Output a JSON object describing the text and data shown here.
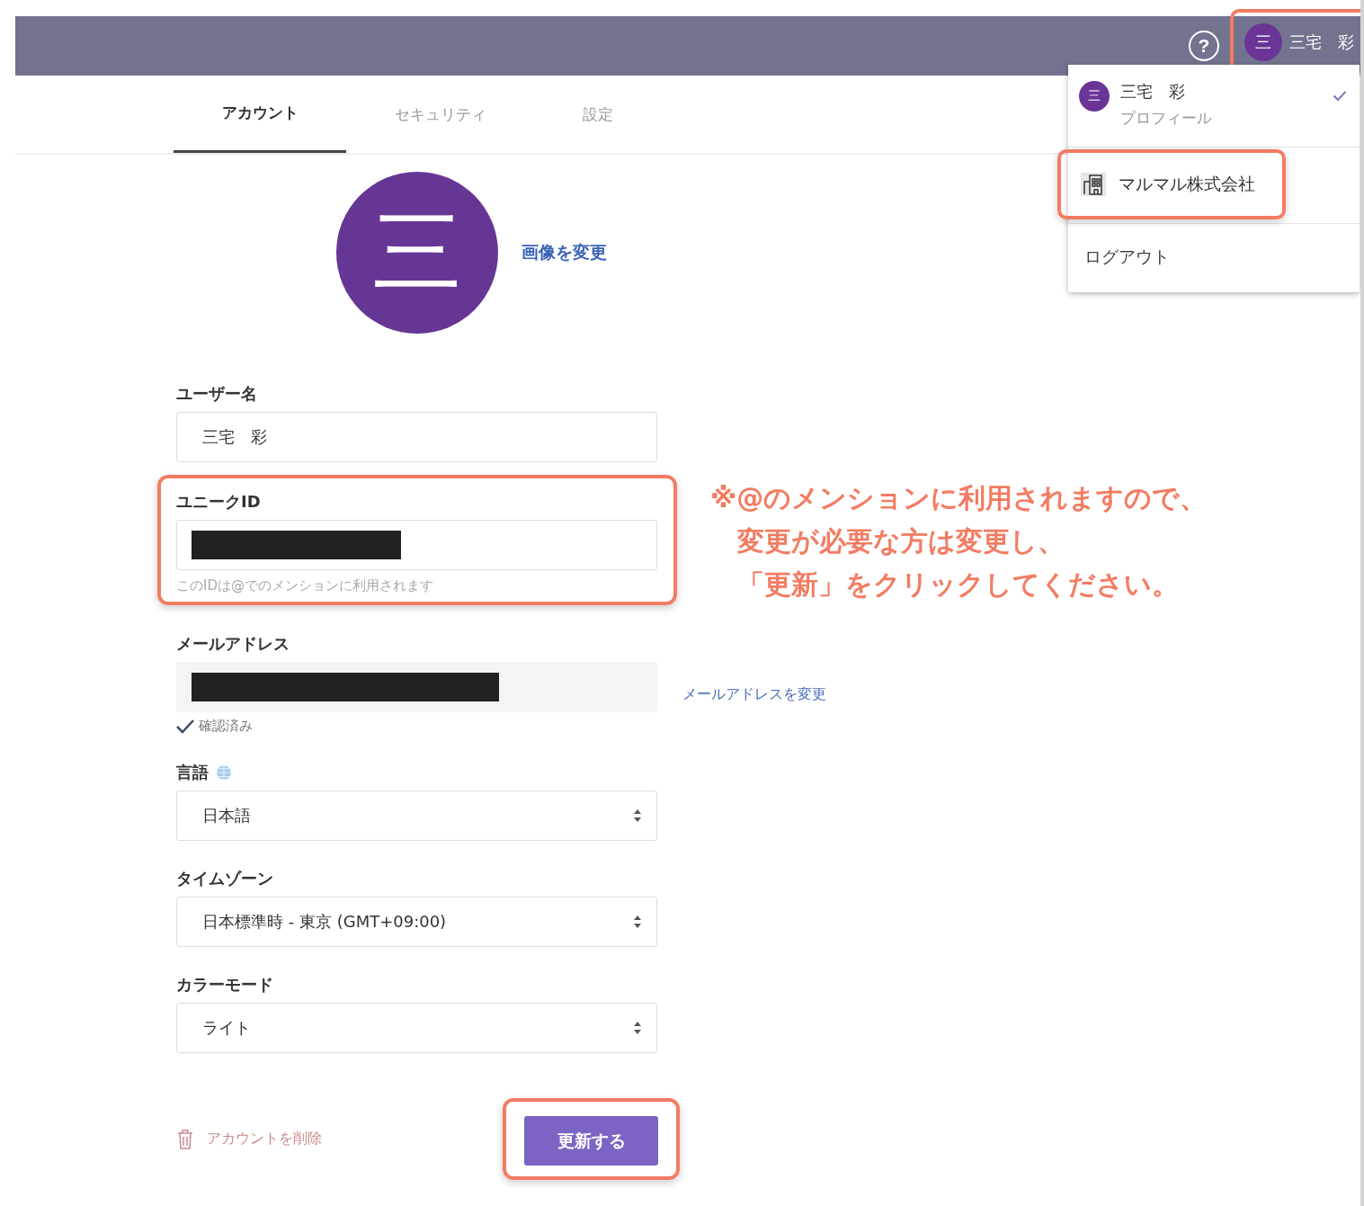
{
  "header": {
    "help_icon": "?",
    "user": {
      "initial": "三",
      "name": "三宅　彩",
      "highlighted": true
    }
  },
  "user_menu": {
    "items": [
      {
        "kind": "profile",
        "initial": "三",
        "title": "三宅　彩",
        "subtitle": "プロフィール",
        "selected": true
      },
      {
        "kind": "organization",
        "title": "マルマル株式会社",
        "selected": false,
        "highlighted": true
      },
      {
        "kind": "logout",
        "title": "ログアウト"
      }
    ]
  },
  "tabs": [
    {
      "label": "アカウント",
      "selected": true
    },
    {
      "label": "セキュリティ",
      "selected": false
    },
    {
      "label": "設定",
      "selected": false
    }
  ],
  "avatar": {
    "initial": "三",
    "change_link": "画像を変更"
  },
  "form": {
    "fields": [
      {
        "kind": "text",
        "label": "ユーザー名",
        "value": "三宅　彩"
      },
      {
        "kind": "text",
        "label": "ユニークID",
        "redacted": true,
        "hint": "このIDは@でのメンションに利用されます",
        "highlighted": true
      },
      {
        "kind": "readonly",
        "label": "メールアドレス",
        "redacted": true,
        "link": "メールアドレスを変更",
        "verified": true,
        "verified_label": "確認済み"
      },
      {
        "kind": "select",
        "label": "言語",
        "label_icon": true,
        "value": "日本語"
      },
      {
        "kind": "select",
        "label": "タイムゾーン",
        "value": "日本標準時 - 東京 (GMT+09:00)"
      },
      {
        "kind": "select",
        "label": "カラーモード",
        "value": "ライト"
      }
    ]
  },
  "delete_link": "アカウントを削除",
  "submit": {
    "label": "更新する",
    "highlighted": true
  },
  "note": {
    "lines": [
      "※@のメンションに利用されますので、",
      "変更が必要な方は変更し、",
      "「更新」をクリックしてください。"
    ]
  }
}
